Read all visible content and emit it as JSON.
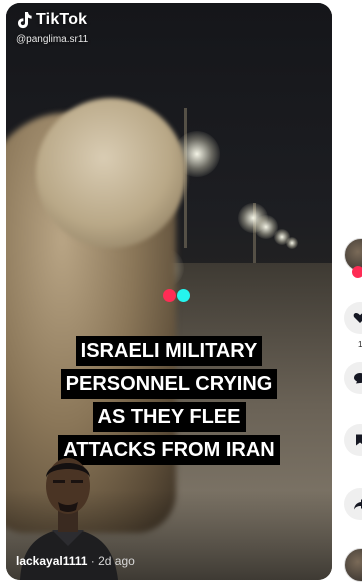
{
  "app": {
    "brand": "TikTok",
    "handle": "@panglima.sr11"
  },
  "overlay": {
    "caption_lines": [
      "ISRAELI MILITARY",
      "PERSONNEL CRYING",
      "AS THEY FLEE",
      "ATTACKS FROM IRAN"
    ]
  },
  "video": {
    "author": "lackayal1111",
    "time": "2d ago"
  },
  "side": {
    "like_count": "1",
    "bookmark_count": ""
  },
  "colors": {
    "record_red": "#fe2c55",
    "record_cyan": "#25f4ee",
    "caption_bg": "#000000"
  }
}
